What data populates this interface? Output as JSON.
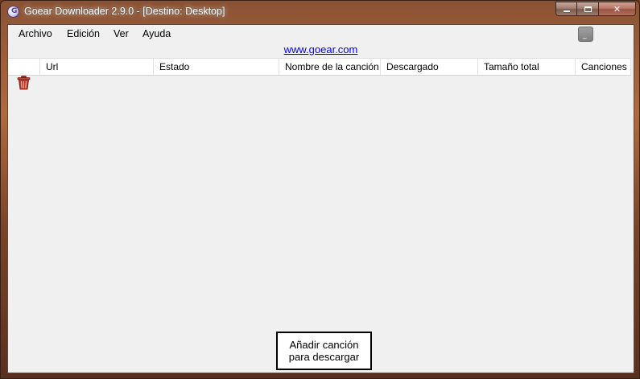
{
  "window": {
    "title": "Goear Downloader 2.9.0 - [Destino: Desktop]"
  },
  "menu": {
    "items": [
      "Archivo",
      "Edición",
      "Ver",
      "Ayuda"
    ]
  },
  "link": {
    "text": "www.goear.com"
  },
  "table": {
    "columns": [
      "Url",
      "Estado",
      "Nombre de la canción",
      "Descargado",
      "Tamaño total",
      "Canciones"
    ]
  },
  "icons": {
    "app": "goear-app-icon",
    "delete": "trash-icon"
  },
  "tooltip": {
    "line1": "Añadir canción",
    "line2": "para descargar"
  },
  "colors": {
    "link": "#0000ee",
    "client_bg": "#f0f0f0",
    "trash": "#c0392b"
  }
}
